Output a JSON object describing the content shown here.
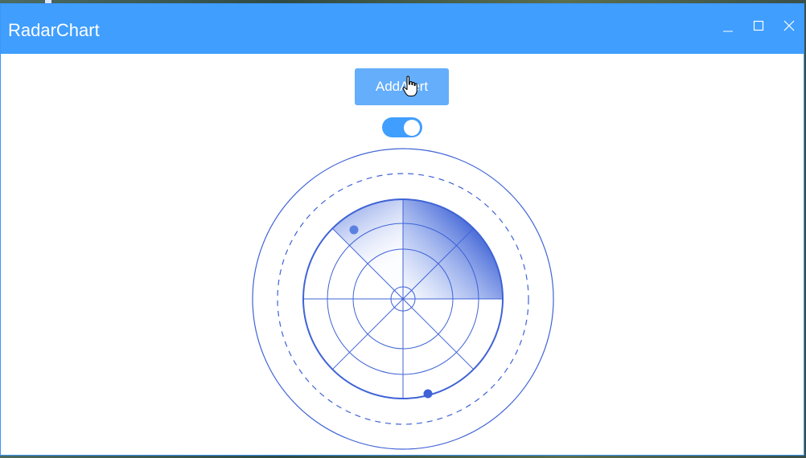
{
  "window": {
    "title": "RadarChart",
    "accent_color": "#409efe"
  },
  "titlebar_controls": {
    "minimize_icon": "minimize-icon",
    "maximize_icon": "maximize-icon",
    "close_icon": "close-icon"
  },
  "main": {
    "add_alert_label": "AddAlert",
    "toggle": {
      "state": "on",
      "color": "#409efe"
    }
  },
  "radar": {
    "stroke_color": "#3f63d6",
    "sweep_color": "#3f63d6",
    "blips": 2,
    "dashed_ring": true
  }
}
